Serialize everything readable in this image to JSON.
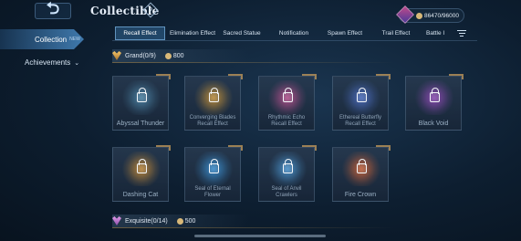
{
  "header": {
    "title": "Collectible",
    "help_glyph": "?",
    "currency_amount": "86470/96000"
  },
  "nav": {
    "active_label": "Collection",
    "active_tag": "NEW",
    "achievements_label": "Achievements"
  },
  "tabs": [
    "Recall Effect",
    "Elimination Effect",
    "Sacred Statue",
    "Notification",
    "Spawn Effect",
    "Trail Effect",
    "Battle I"
  ],
  "sections": {
    "grand": {
      "label": "Grand(0/9)",
      "tokens": "800"
    },
    "exquisite": {
      "label": "Exquisite(0/14)",
      "tokens": "500"
    }
  },
  "cards": [
    {
      "name": "Abyssal Thunder",
      "color": "#4a7fa0"
    },
    {
      "name": "Converging Blades\nRecall Effect",
      "color": "#b88a3a"
    },
    {
      "name": "Rhythmic Echo\nRecall Effect",
      "color": "#b0508a"
    },
    {
      "name": "Ethereal Butterfly\nRecall Effect",
      "color": "#4a6ab8"
    },
    {
      "name": "Black Void",
      "color": "#8a4ab0"
    },
    {
      "name": "Dashing Cat",
      "color": "#b8843a"
    },
    {
      "name": "Seal of Eternal\nFlower",
      "color": "#3a8ac8"
    },
    {
      "name": "Seal of Anvil\nCrawlers",
      "color": "#4a90c8"
    },
    {
      "name": "Fire Crown",
      "color": "#c0603a"
    }
  ]
}
